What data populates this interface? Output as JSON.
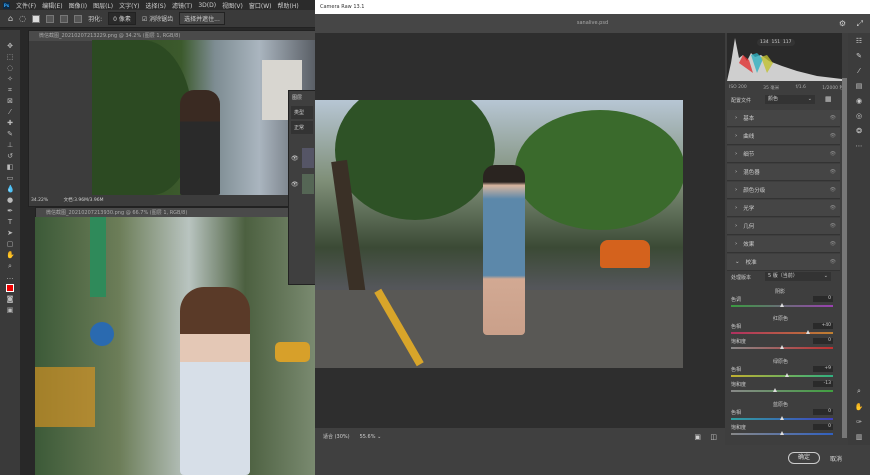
{
  "menubar": {
    "items": [
      "文件(F)",
      "编辑(E)",
      "图像(I)",
      "图层(L)",
      "文字(Y)",
      "选择(S)",
      "滤镜(T)",
      "3D(D)",
      "视图(V)",
      "窗口(W)",
      "帮助(H)"
    ]
  },
  "options": {
    "feather_label": "羽化:",
    "feather_value": "0 像素",
    "antialias": "消除锯齿",
    "select_mask": "选择并遮住..."
  },
  "doc1": {
    "title": "微信截图_20210207213229.png @ 34.2% (图层 1, RGB/8)",
    "zoom": "34.22%",
    "doc_size": "文档:3.96M/3.96M"
  },
  "doc2": {
    "title": "微信截图_20210207213930.png @ 66.7% (图层 1, RGB/8)"
  },
  "layers": {
    "tab": "图层",
    "search": "类型",
    "mode": "正常"
  },
  "camera_raw": {
    "title": "Camera Raw 13.1",
    "filename": "sanalive.psd",
    "histogram": {
      "rgb": [
        "134",
        "151",
        "117"
      ],
      "iso": "ISO 200",
      "focal": "35 毫米",
      "aperture": "f/1.6",
      "shutter": "1/2000 秒"
    },
    "profile_label": "配置文件",
    "profile_value": "颜色",
    "sections": [
      "基本",
      "曲线",
      "细节",
      "混色器",
      "颜色分级",
      "光学",
      "几何",
      "效果",
      "校准"
    ],
    "calibration": {
      "process_label": "处理版本",
      "process_value": "5 版（当前）",
      "shadows": {
        "title": "阴影",
        "tint_label": "色调",
        "tint": "0",
        "tint_pos": 0.5
      },
      "red": {
        "title": "红原色",
        "hue_label": "色相",
        "hue": "+40",
        "hue_pos": 0.75,
        "sat_label": "饱和度",
        "sat": "0",
        "sat_pos": 0.5
      },
      "green": {
        "title": "绿原色",
        "hue_label": "色相",
        "hue": "+9",
        "hue_pos": 0.55,
        "sat_label": "饱和度",
        "sat": "-13",
        "sat_pos": 0.43
      },
      "blue": {
        "title": "蓝原色",
        "hue_label": "色相",
        "hue": "0",
        "hue_pos": 0.5,
        "sat_label": "饱和度",
        "sat": "0",
        "sat_pos": 0.5
      }
    },
    "zoom_fit": "适合 (30%)",
    "zoom_value": "55.6%",
    "ok": "确定",
    "cancel": "取消"
  }
}
